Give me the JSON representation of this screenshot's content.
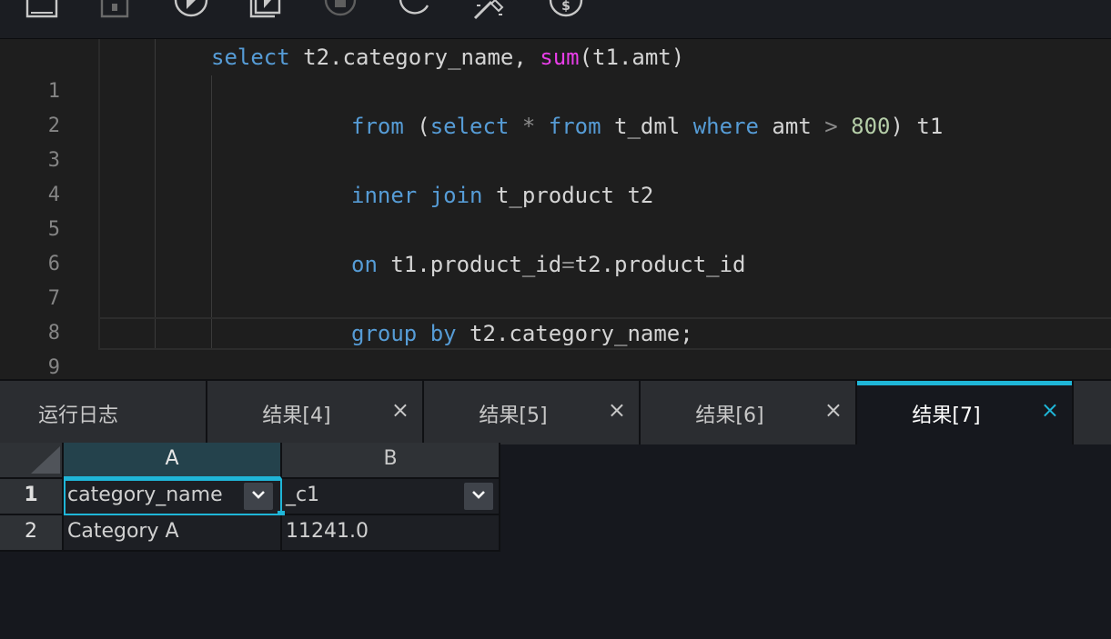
{
  "toolbar": {
    "icons": [
      "save-icon",
      "format-icon",
      "run-icon",
      "run-all-icon",
      "stop-icon",
      "refresh-icon",
      "magic-wand-icon",
      "cost-icon"
    ]
  },
  "editor": {
    "line_numbers": [
      "1",
      "2",
      "3",
      "4",
      "5",
      "6",
      "7",
      "8",
      "9"
    ],
    "lines": {
      "l1": {
        "kw1": "select",
        "t1": " t2.category_name, ",
        "fn": "sum",
        "t2": "(t1.amt)"
      },
      "l3": {
        "kw1": "from",
        "t1": " (",
        "kw2": "select",
        "op1": " * ",
        "kw3": "from",
        "t2": " t_dml ",
        "kw4": "where",
        "t3": " amt ",
        "op2": ">",
        "t4": " ",
        "num": "800",
        "t5": ") t1"
      },
      "l5": {
        "kw1": "inner",
        "t1": " ",
        "kw2": "join",
        "t2": " t_product t2"
      },
      "l7": {
        "kw1": "on",
        "t1": " t1.product_id",
        "op": "=",
        "t2": "t2.product_id"
      },
      "l9": {
        "kw1": "group",
        "t1": " ",
        "kw2": "by",
        "t2": " t2.category_name;"
      }
    }
  },
  "tabs": [
    {
      "label": "运行日志",
      "closable": false,
      "active": false
    },
    {
      "label": "结果[4]",
      "close": "×",
      "active": false
    },
    {
      "label": "结果[5]",
      "close": "×",
      "active": false
    },
    {
      "label": "结果[6]",
      "close": "×",
      "active": false
    },
    {
      "label": "结果[7]",
      "close": "×",
      "active": true
    }
  ],
  "grid": {
    "columns": [
      "A",
      "B"
    ],
    "rows": [
      {
        "num": "1",
        "cells": [
          "category_name",
          "_c1"
        ]
      },
      {
        "num": "2",
        "cells": [
          "Category A",
          "11241.0"
        ]
      }
    ]
  },
  "colors": {
    "accent": "#1fb6d8",
    "keyword": "#569cd6",
    "function": "#e83ee8",
    "number": "#b5cea8"
  }
}
